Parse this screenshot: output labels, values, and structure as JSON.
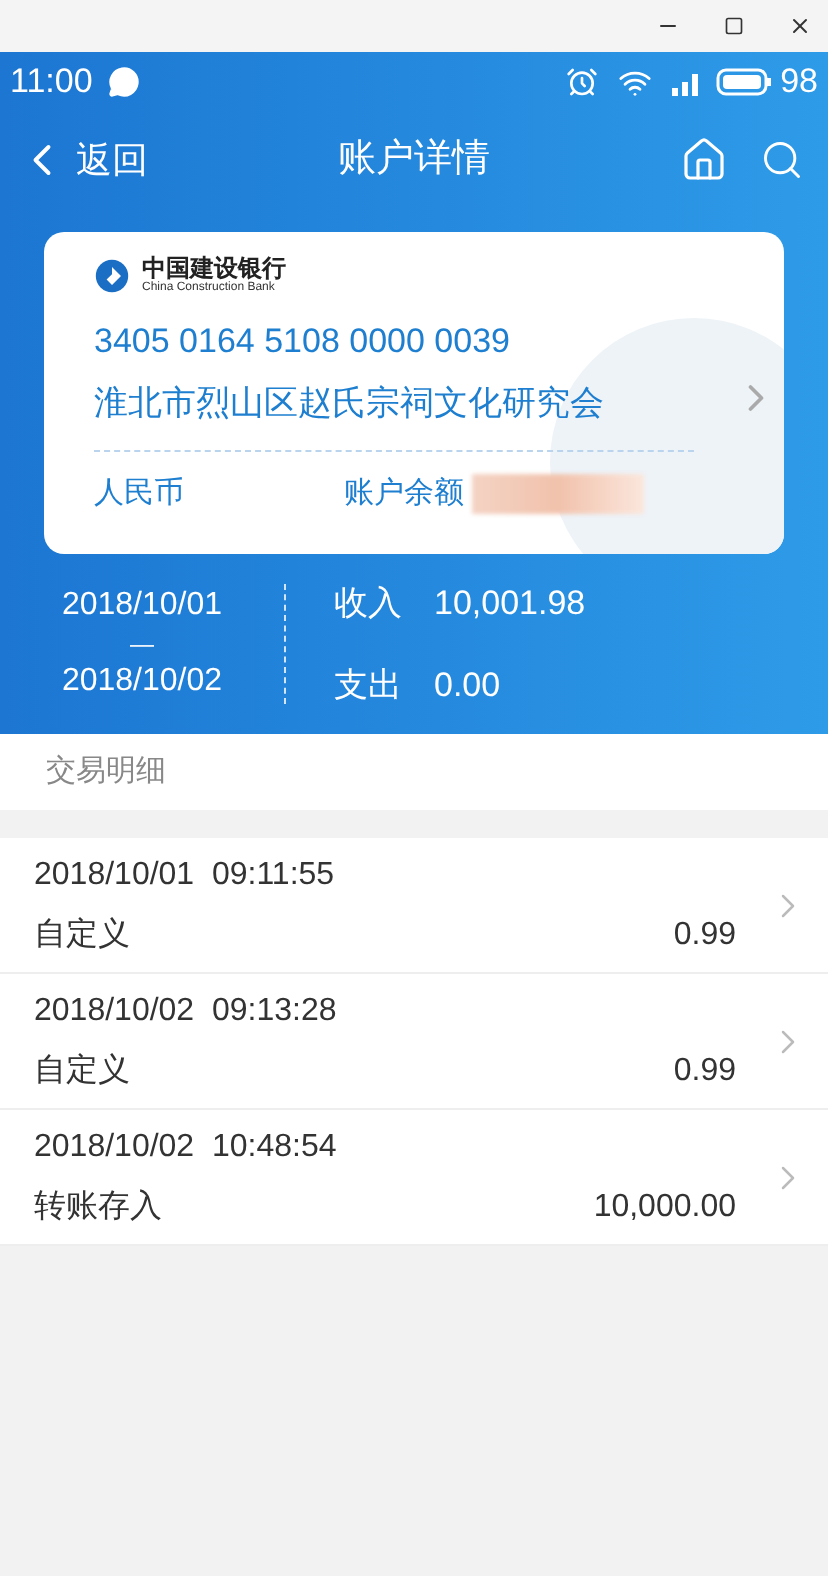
{
  "status_bar": {
    "time": "11:00",
    "battery": "98"
  },
  "header": {
    "back": "返回",
    "title": "账户详情"
  },
  "card": {
    "bank_name": "中国建设银行",
    "bank_name_en": "China Construction Bank",
    "account_number": "3405 0164 5108 0000 0039",
    "account_name": "淮北市烈山区赵氏宗祠文化研究会",
    "currency": "人民币",
    "balance_label": "账户余额"
  },
  "summary": {
    "date_from": "2018/10/01",
    "separator": "—",
    "date_to": "2018/10/02",
    "income_label": "收入",
    "income": "10,001.98",
    "expense_label": "支出",
    "expense": "0.00"
  },
  "section_title": "交易明细",
  "transactions": [
    {
      "date": "2018/10/01",
      "time": "09:11:55",
      "type": "自定义",
      "amount": "0.99"
    },
    {
      "date": "2018/10/02",
      "time": "09:13:28",
      "type": "自定义",
      "amount": "0.99"
    },
    {
      "date": "2018/10/02",
      "time": "10:48:54",
      "type": "转账存入",
      "amount": "10,000.00"
    }
  ]
}
